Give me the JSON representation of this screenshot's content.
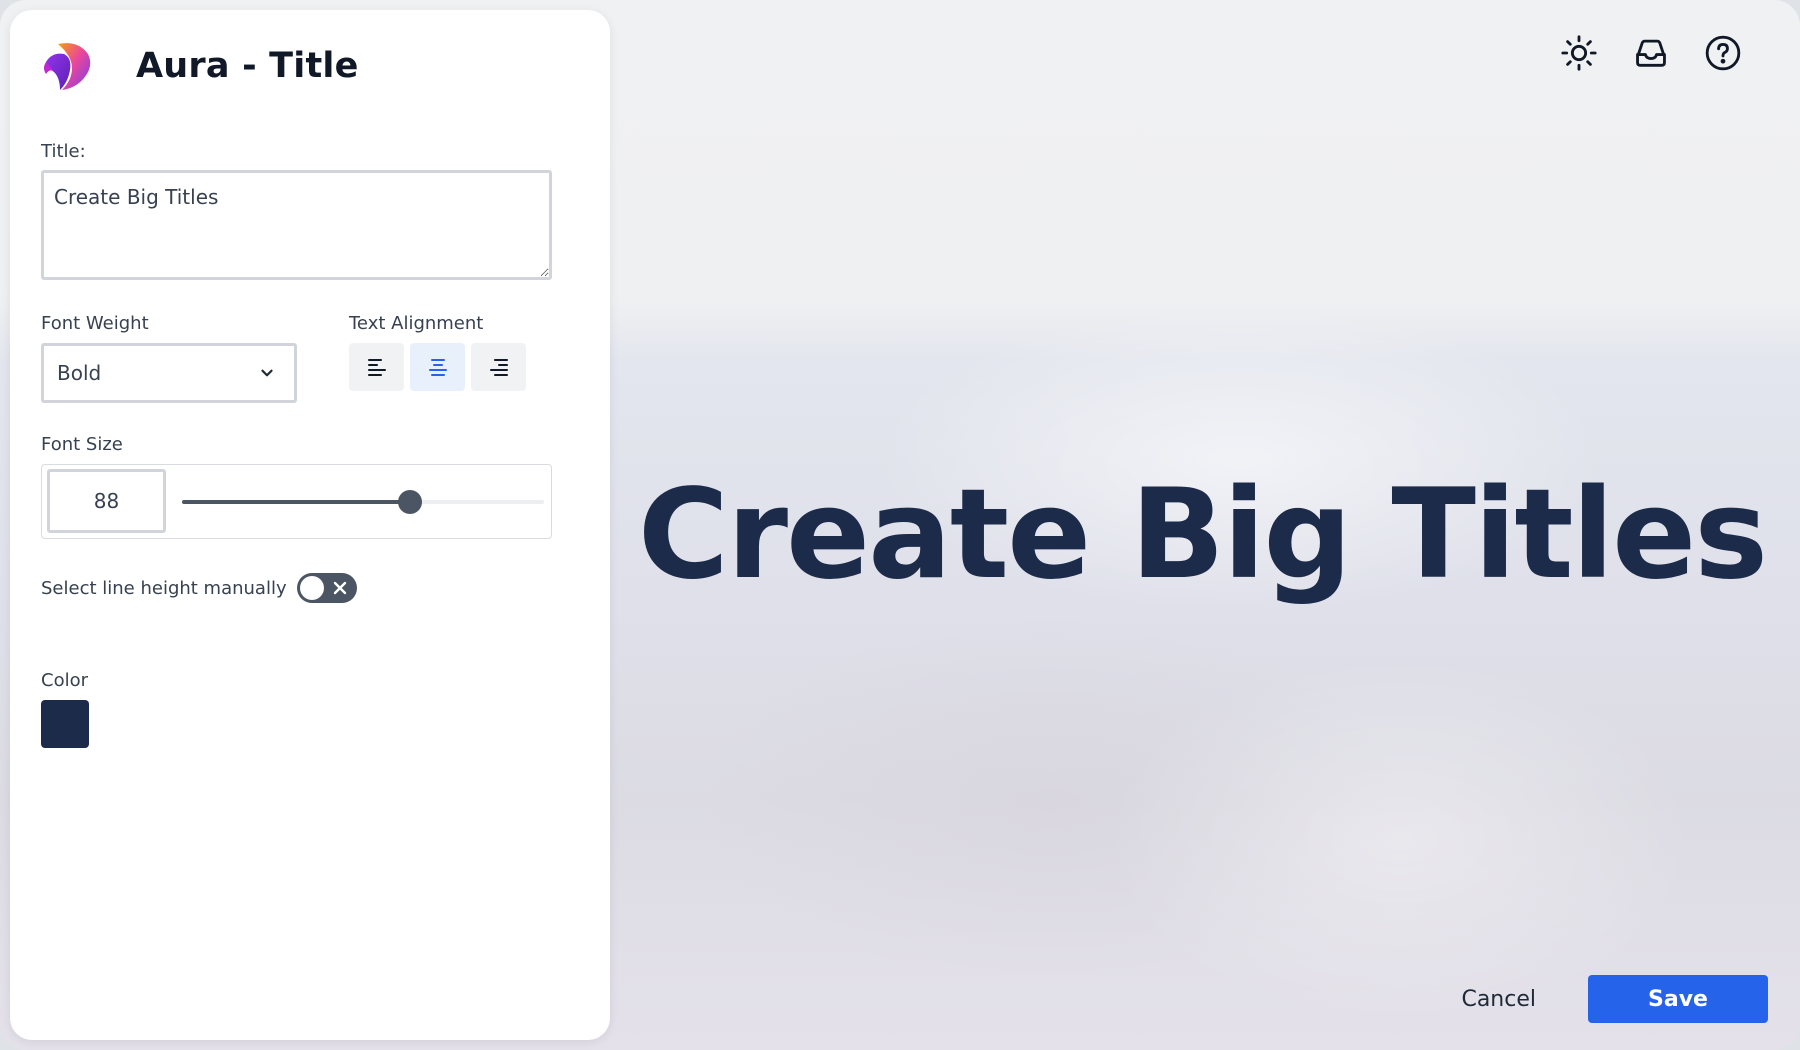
{
  "panel": {
    "app_title": "Aura - Title",
    "title_label": "Title:",
    "title_value": "Create Big Titles",
    "font_weight_label": "Font Weight",
    "font_weight_value": "Bold",
    "text_alignment_label": "Text Alignment",
    "alignment_options": [
      "left",
      "center",
      "right"
    ],
    "alignment_selected": "center",
    "font_size_label": "Font Size",
    "font_size_value": "88",
    "font_size_slider_fraction": 0.63,
    "line_height_label": "Select line height manually",
    "line_height_manual": false,
    "color_label": "Color",
    "color_value": "#1c2b4a"
  },
  "preview": {
    "title_text": "Create Big Titles"
  },
  "top_icons": [
    "sun-icon",
    "inbox-icon",
    "help-circle-icon"
  ],
  "footer": {
    "cancel_label": "Cancel",
    "save_label": "Save"
  },
  "colors": {
    "accent": "#2563eb",
    "title_color": "#1c2b4a",
    "control_dark": "#4b5563"
  }
}
